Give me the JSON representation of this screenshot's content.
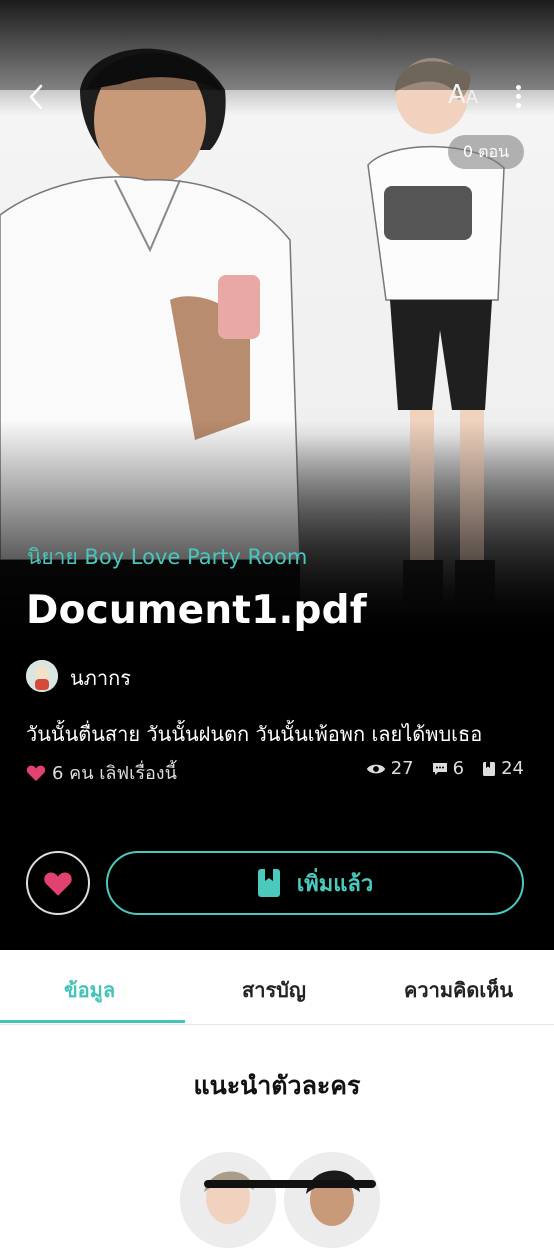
{
  "topbar": {
    "back_icon": "chevron-left-icon",
    "font_size_label": "A",
    "font_size_label_small": "A",
    "more_icon": "more-vertical-icon",
    "episode_badge": "0 ตอน"
  },
  "novel": {
    "category": "นิยาย Boy Love Party Room",
    "title": "Document1.pdf",
    "author": "นภากร",
    "tagline": "วันนั้นตื่นสาย วันนั้นฝนตก วันนั้นเพ้อพก เลยได้พบเธอ",
    "likes_text": "6 คน เลิฟเรื่องนี้",
    "stats": {
      "views": "27",
      "comments": "6",
      "chapters": "24"
    }
  },
  "actions": {
    "favorite_icon": "heart-icon",
    "add_icon": "bookmark-icon",
    "add_label": "เพิ่มแล้ว"
  },
  "tabs": [
    {
      "label": "ข้อมูล"
    },
    {
      "label": "สารบัญ"
    },
    {
      "label": "ความคิดเห็น"
    }
  ],
  "section": {
    "title": "แนะนำตัวละคร"
  },
  "colors": {
    "accent": "#45c3b8",
    "heart": "#e2426f"
  }
}
